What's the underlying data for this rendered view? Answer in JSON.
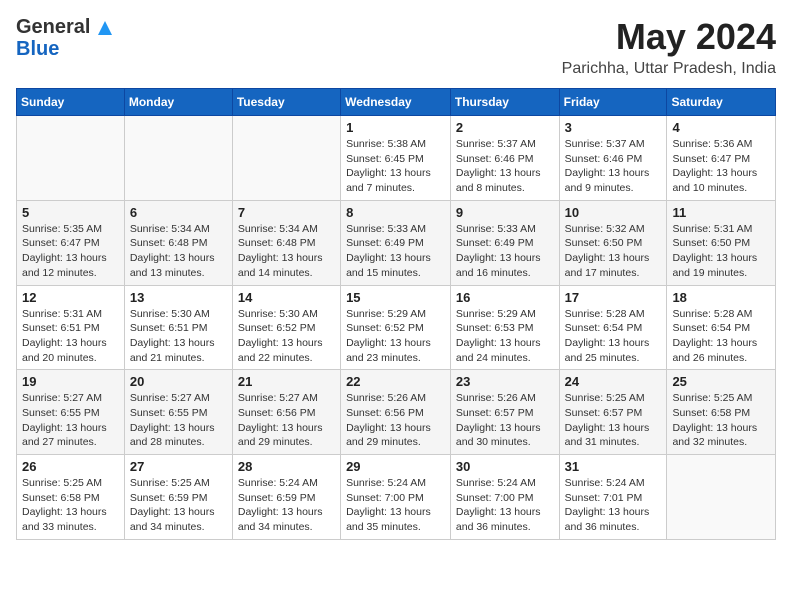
{
  "header": {
    "logo_general": "General",
    "logo_blue": "Blue",
    "title": "May 2024",
    "subtitle": "Parichha, Uttar Pradesh, India"
  },
  "days_of_week": [
    "Sunday",
    "Monday",
    "Tuesday",
    "Wednesday",
    "Thursday",
    "Friday",
    "Saturday"
  ],
  "weeks": [
    [
      {
        "day": "",
        "info": ""
      },
      {
        "day": "",
        "info": ""
      },
      {
        "day": "",
        "info": ""
      },
      {
        "day": "1",
        "info": "Sunrise: 5:38 AM\nSunset: 6:45 PM\nDaylight: 13 hours\nand 7 minutes."
      },
      {
        "day": "2",
        "info": "Sunrise: 5:37 AM\nSunset: 6:46 PM\nDaylight: 13 hours\nand 8 minutes."
      },
      {
        "day": "3",
        "info": "Sunrise: 5:37 AM\nSunset: 6:46 PM\nDaylight: 13 hours\nand 9 minutes."
      },
      {
        "day": "4",
        "info": "Sunrise: 5:36 AM\nSunset: 6:47 PM\nDaylight: 13 hours\nand 10 minutes."
      }
    ],
    [
      {
        "day": "5",
        "info": "Sunrise: 5:35 AM\nSunset: 6:47 PM\nDaylight: 13 hours\nand 12 minutes."
      },
      {
        "day": "6",
        "info": "Sunrise: 5:34 AM\nSunset: 6:48 PM\nDaylight: 13 hours\nand 13 minutes."
      },
      {
        "day": "7",
        "info": "Sunrise: 5:34 AM\nSunset: 6:48 PM\nDaylight: 13 hours\nand 14 minutes."
      },
      {
        "day": "8",
        "info": "Sunrise: 5:33 AM\nSunset: 6:49 PM\nDaylight: 13 hours\nand 15 minutes."
      },
      {
        "day": "9",
        "info": "Sunrise: 5:33 AM\nSunset: 6:49 PM\nDaylight: 13 hours\nand 16 minutes."
      },
      {
        "day": "10",
        "info": "Sunrise: 5:32 AM\nSunset: 6:50 PM\nDaylight: 13 hours\nand 17 minutes."
      },
      {
        "day": "11",
        "info": "Sunrise: 5:31 AM\nSunset: 6:50 PM\nDaylight: 13 hours\nand 19 minutes."
      }
    ],
    [
      {
        "day": "12",
        "info": "Sunrise: 5:31 AM\nSunset: 6:51 PM\nDaylight: 13 hours\nand 20 minutes."
      },
      {
        "day": "13",
        "info": "Sunrise: 5:30 AM\nSunset: 6:51 PM\nDaylight: 13 hours\nand 21 minutes."
      },
      {
        "day": "14",
        "info": "Sunrise: 5:30 AM\nSunset: 6:52 PM\nDaylight: 13 hours\nand 22 minutes."
      },
      {
        "day": "15",
        "info": "Sunrise: 5:29 AM\nSunset: 6:52 PM\nDaylight: 13 hours\nand 23 minutes."
      },
      {
        "day": "16",
        "info": "Sunrise: 5:29 AM\nSunset: 6:53 PM\nDaylight: 13 hours\nand 24 minutes."
      },
      {
        "day": "17",
        "info": "Sunrise: 5:28 AM\nSunset: 6:54 PM\nDaylight: 13 hours\nand 25 minutes."
      },
      {
        "day": "18",
        "info": "Sunrise: 5:28 AM\nSunset: 6:54 PM\nDaylight: 13 hours\nand 26 minutes."
      }
    ],
    [
      {
        "day": "19",
        "info": "Sunrise: 5:27 AM\nSunset: 6:55 PM\nDaylight: 13 hours\nand 27 minutes."
      },
      {
        "day": "20",
        "info": "Sunrise: 5:27 AM\nSunset: 6:55 PM\nDaylight: 13 hours\nand 28 minutes."
      },
      {
        "day": "21",
        "info": "Sunrise: 5:27 AM\nSunset: 6:56 PM\nDaylight: 13 hours\nand 29 minutes."
      },
      {
        "day": "22",
        "info": "Sunrise: 5:26 AM\nSunset: 6:56 PM\nDaylight: 13 hours\nand 29 minutes."
      },
      {
        "day": "23",
        "info": "Sunrise: 5:26 AM\nSunset: 6:57 PM\nDaylight: 13 hours\nand 30 minutes."
      },
      {
        "day": "24",
        "info": "Sunrise: 5:25 AM\nSunset: 6:57 PM\nDaylight: 13 hours\nand 31 minutes."
      },
      {
        "day": "25",
        "info": "Sunrise: 5:25 AM\nSunset: 6:58 PM\nDaylight: 13 hours\nand 32 minutes."
      }
    ],
    [
      {
        "day": "26",
        "info": "Sunrise: 5:25 AM\nSunset: 6:58 PM\nDaylight: 13 hours\nand 33 minutes."
      },
      {
        "day": "27",
        "info": "Sunrise: 5:25 AM\nSunset: 6:59 PM\nDaylight: 13 hours\nand 34 minutes."
      },
      {
        "day": "28",
        "info": "Sunrise: 5:24 AM\nSunset: 6:59 PM\nDaylight: 13 hours\nand 34 minutes."
      },
      {
        "day": "29",
        "info": "Sunrise: 5:24 AM\nSunset: 7:00 PM\nDaylight: 13 hours\nand 35 minutes."
      },
      {
        "day": "30",
        "info": "Sunrise: 5:24 AM\nSunset: 7:00 PM\nDaylight: 13 hours\nand 36 minutes."
      },
      {
        "day": "31",
        "info": "Sunrise: 5:24 AM\nSunset: 7:01 PM\nDaylight: 13 hours\nand 36 minutes."
      },
      {
        "day": "",
        "info": ""
      }
    ]
  ]
}
